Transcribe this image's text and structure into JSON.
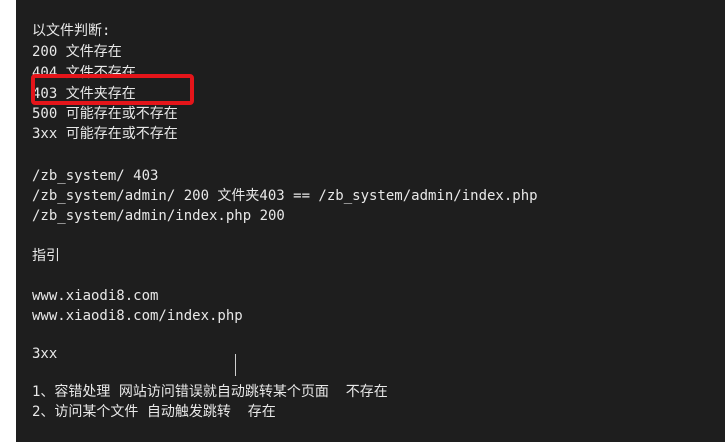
{
  "editor": {
    "lines": [
      "以文件判断:",
      "200 文件存在",
      "404 文件不存在",
      "403 文件夹存在",
      "500 可能存在或不存在",
      "3xx 可能存在或不存在",
      "/zb_system/ 403",
      "/zb_system/admin/ 200 文件夹403 == /zb_system/admin/index.php",
      "/zb_system/admin/index.php 200",
      "指引",
      "www.xiaodi8.com",
      "www.xiaodi8.com/index.php",
      "3xx",
      "1、容错处理 网站访问错误就自动跳转某个页面  不存在",
      "2、访问某个文件 自动触发跳转  存在"
    ]
  },
  "colors": {
    "background": "#1e1e1e",
    "text": "#e8e8e8",
    "highlight": "#e4151a"
  }
}
